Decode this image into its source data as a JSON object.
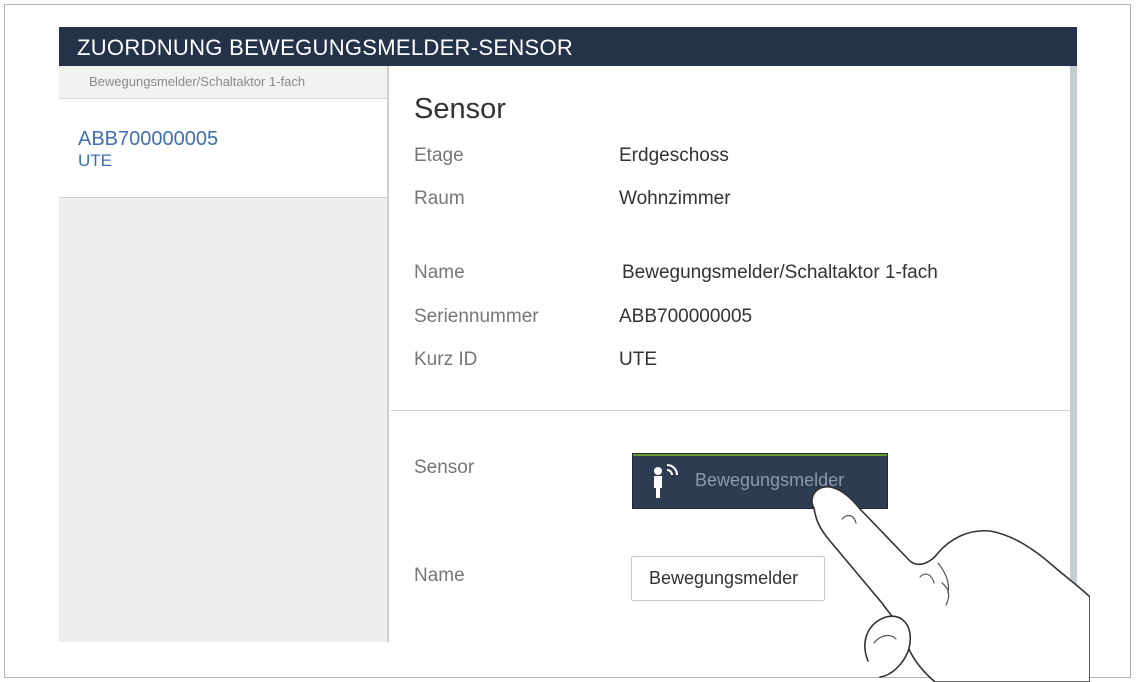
{
  "window": {
    "title": "ZUORDNUNG BEWEGUNGSMELDER-SENSOR"
  },
  "sidebar": {
    "breadcrumb": "Bewegungsmelder/Schaltaktor 1-fach",
    "items": [
      {
        "serial": "ABB700000005",
        "short_id": "UTE"
      }
    ]
  },
  "main": {
    "section_title": "Sensor",
    "details": {
      "etage_label": "Etage",
      "etage_value": "Erdgeschoss",
      "raum_label": "Raum",
      "raum_value": "Wohnzimmer",
      "name_label": "Name",
      "name_value": "Bewegungsmelder/Schaltaktor 1-fach",
      "serial_label": "Seriennummer",
      "serial_value": "ABB700000005",
      "shortid_label": "Kurz ID",
      "shortid_value": "UTE"
    },
    "assignment": {
      "sensor_label": "Sensor",
      "sensor_button_label": "Bewegungsmelder",
      "sensor_button_icon": "motion-detector-icon",
      "name_label": "Name",
      "name_input_value": "Bewegungsmelder"
    }
  },
  "colors": {
    "titlebar": "#24324a",
    "link": "#3f6fae",
    "button": "#2e3b50",
    "button_accent": "#6a9a2a"
  }
}
